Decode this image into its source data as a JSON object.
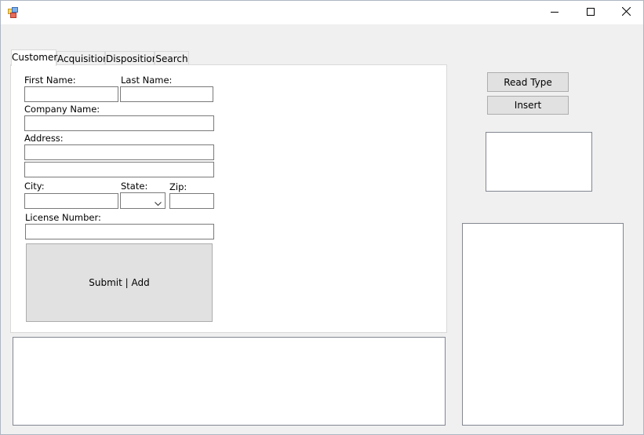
{
  "window": {
    "title": "",
    "controls": {
      "minimize": "—",
      "maximize": "☐",
      "close": "✕"
    }
  },
  "tabs": [
    {
      "label": "Customer",
      "active": true
    },
    {
      "label": "Acquisition",
      "active": false
    },
    {
      "label": "Disposition",
      "active": false
    },
    {
      "label": "Search",
      "active": false
    }
  ],
  "customer_form": {
    "first_name_label": "First Name:",
    "last_name_label": "Last Name:",
    "company_name_label": "Company Name:",
    "address_label": "Address:",
    "city_label": "City:",
    "state_label": "State:",
    "zip_label": "Zip:",
    "license_number_label": "License Number:",
    "first_name_value": "",
    "last_name_value": "",
    "company_name_value": "",
    "address_line1_value": "",
    "address_line2_value": "",
    "city_value": "",
    "state_value": "",
    "zip_value": "",
    "license_number_value": "",
    "submit_label": "Submit | Add"
  },
  "side_buttons": {
    "read_type_label": "Read Type",
    "insert_label": "Insert"
  },
  "icons": [
    "app-icon",
    "minimize-icon",
    "maximize-icon",
    "close-icon",
    "chevron-down-icon"
  ]
}
